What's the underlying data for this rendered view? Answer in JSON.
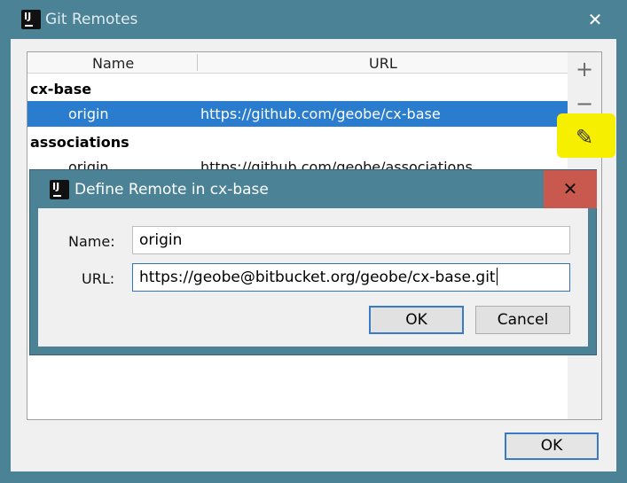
{
  "outer_window": {
    "title": "Git Remotes",
    "close_glyph": "✕",
    "app_icon_text": "IJ",
    "ok_label": "OK"
  },
  "table": {
    "columns": [
      "Name",
      "URL"
    ],
    "groups": [
      {
        "name": "cx-base",
        "rows": [
          {
            "name": "origin",
            "url": "https://github.com/geobe/cx-base",
            "selected": true
          }
        ]
      },
      {
        "name": "associations",
        "rows": [
          {
            "name": "origin",
            "url": "https://github.com/geobe/associations",
            "selected": false
          }
        ]
      }
    ]
  },
  "toolbar": {
    "add_glyph": "+",
    "remove_glyph": "−",
    "edit_glyph": "✎",
    "highlight_color": "#f6f000"
  },
  "dialog": {
    "title": "Define Remote in cx-base",
    "close_glyph": "✕",
    "name_label": "Name:",
    "name_value": "origin",
    "url_label": "URL:",
    "url_value": "https://geobe@bitbucket.org/geobe/cx-base.git",
    "ok_label": "OK",
    "cancel_label": "Cancel"
  },
  "colors": {
    "titlebar": "#4b8296",
    "selection": "#2a7ccf",
    "close_hover": "#c9594e",
    "focus_border": "#3a7bc8"
  }
}
